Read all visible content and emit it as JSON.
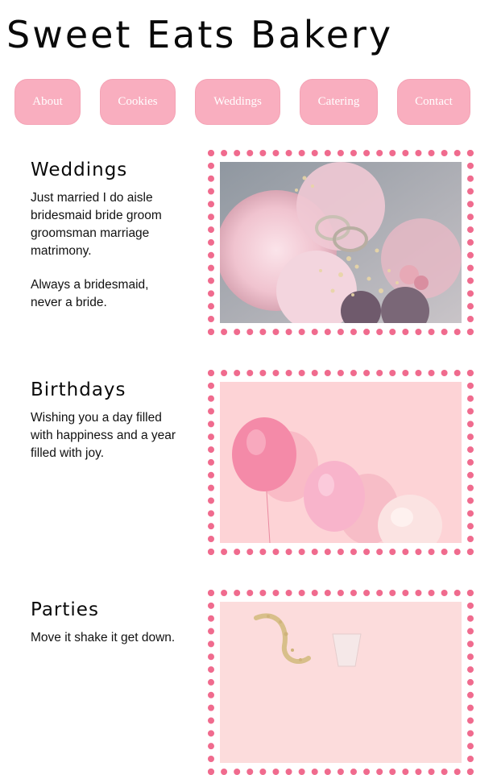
{
  "site": {
    "title": "Sweet Eats Bakery"
  },
  "nav": {
    "items": [
      {
        "label": "About"
      },
      {
        "label": "Cookies"
      },
      {
        "label": "Weddings"
      },
      {
        "label": "Catering"
      },
      {
        "label": "Contact"
      }
    ]
  },
  "sections": [
    {
      "heading": "Weddings",
      "paragraphs": [
        "Just married I do aisle bridesmaid bride groom groomsman marriage matrimony.",
        "Always a bridesmaid, never a bride."
      ],
      "image": "wedding-rings-bouquet"
    },
    {
      "heading": "Birthdays",
      "paragraphs": [
        "Wishing you a day filled with happiness and a year filled with joy."
      ],
      "image": "pink-balloons"
    },
    {
      "heading": "Parties",
      "paragraphs": [
        "Move it shake it get down."
      ],
      "image": "party-glitter"
    }
  ],
  "colors": {
    "nav_button": "#f9aebf",
    "frame_dots": "#f06b8e"
  }
}
